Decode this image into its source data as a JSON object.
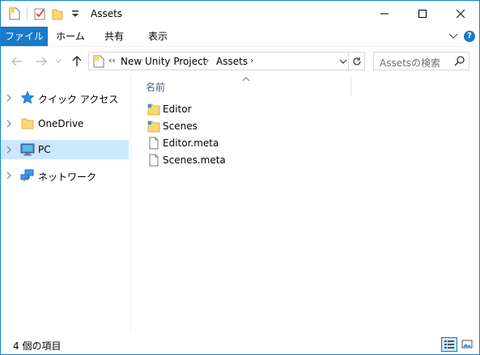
{
  "window": {
    "title": "Assets"
  },
  "ribbon": {
    "tabs": [
      {
        "label": "ファイル"
      },
      {
        "label": "ホーム"
      },
      {
        "label": "共有"
      },
      {
        "label": "表示"
      }
    ],
    "help_label": "?"
  },
  "address": {
    "overflow": "‹‹",
    "crumbs": [
      "New Unity Project",
      "Assets"
    ],
    "separator": "›"
  },
  "search": {
    "placeholder": "Assetsの検索"
  },
  "nav_pane": {
    "items": [
      {
        "label": "クイック アクセス",
        "icon": "star-icon"
      },
      {
        "label": "OneDrive",
        "icon": "onedrive-folder-icon"
      },
      {
        "label": "PC",
        "icon": "pc-icon",
        "selected": true
      },
      {
        "label": "ネットワーク",
        "icon": "network-icon"
      }
    ]
  },
  "content": {
    "column_name": "名前",
    "files": [
      {
        "name": "Editor",
        "type": "folder"
      },
      {
        "name": "Scenes",
        "type": "folder"
      },
      {
        "name": "Editor.meta",
        "type": "file"
      },
      {
        "name": "Scenes.meta",
        "type": "file"
      }
    ]
  },
  "status": {
    "item_count": "4 個の項目"
  },
  "colors": {
    "accent": "#1979ca",
    "selection": "#cce8ff",
    "folder": "#f8d775"
  }
}
